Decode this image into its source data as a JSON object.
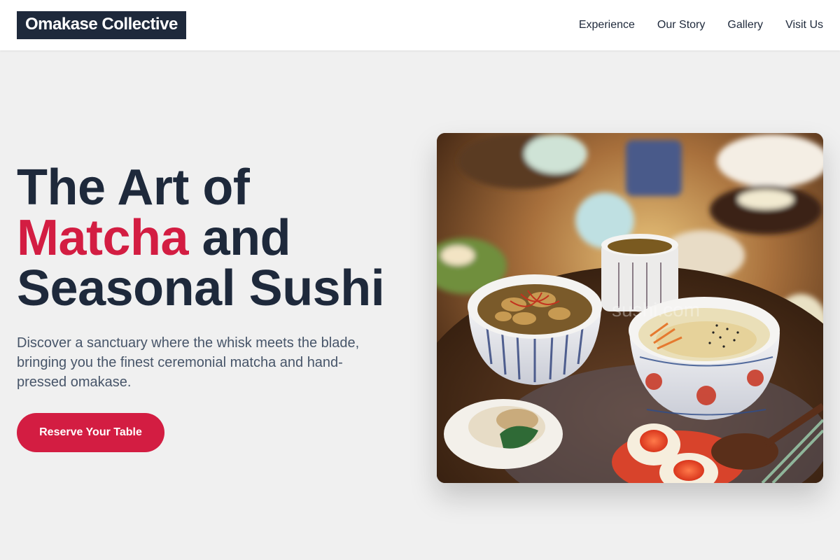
{
  "header": {
    "logo": "Omakase Collective",
    "nav": [
      {
        "label": "Experience"
      },
      {
        "label": "Our Story"
      },
      {
        "label": "Gallery"
      },
      {
        "label": "Visit Us"
      }
    ]
  },
  "hero": {
    "headline_line1": "The Art of",
    "headline_accent": "Matcha",
    "headline_after_accent": " and",
    "headline_line3": "Seasonal Sushi",
    "description": "Discover a sanctuary where the whisk meets the blade, bringing you the finest ceremonial matcha and hand-pressed omakase.",
    "cta_label": "Reserve Your Table",
    "image_watermark": "sushi.com"
  },
  "colors": {
    "brand_dark": "#1e293b",
    "accent": "#d31d42",
    "body_text": "#475569",
    "page_bg": "#f0f0f0"
  }
}
